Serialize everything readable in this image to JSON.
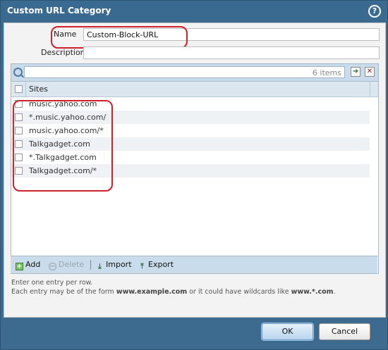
{
  "dialog": {
    "title": "Custom URL Category",
    "help_icon": "?"
  },
  "form": {
    "name_label": "Name",
    "name_value": "Custom-Block-URL",
    "description_label": "Description",
    "description_value": ""
  },
  "grid": {
    "items_count": "6 items",
    "header": "Sites",
    "rows": [
      "music.yahoo.com",
      "*.music.yahoo.com/",
      "music.yahoo.com/*",
      "Talkgadget.com",
      "*.Talkgadget.com",
      "Talkgadget.com/*"
    ]
  },
  "actions": {
    "add": "Add",
    "delete": "Delete",
    "import": "Import",
    "export": "Export"
  },
  "hints": {
    "line1": "Enter one entry per row.",
    "line2_prefix": "Each entry may be of the form ",
    "line2_example": "www.example.com",
    "line2_middle": " or it could have wildcards like ",
    "line2_wildcard": "www.*.com",
    "line2_suffix": "."
  },
  "footer": {
    "ok": "OK",
    "cancel": "Cancel"
  },
  "colors": {
    "highlight": "#d0202b",
    "title_bar": "#3b6a90"
  },
  "icons": {
    "help": "help-icon",
    "search": "search-icon",
    "apply_filter": "arrow-right-icon",
    "clear_filter": "close-icon",
    "add": "plus-icon",
    "delete": "minus-icon",
    "import": "import-icon",
    "export": "export-icon"
  }
}
